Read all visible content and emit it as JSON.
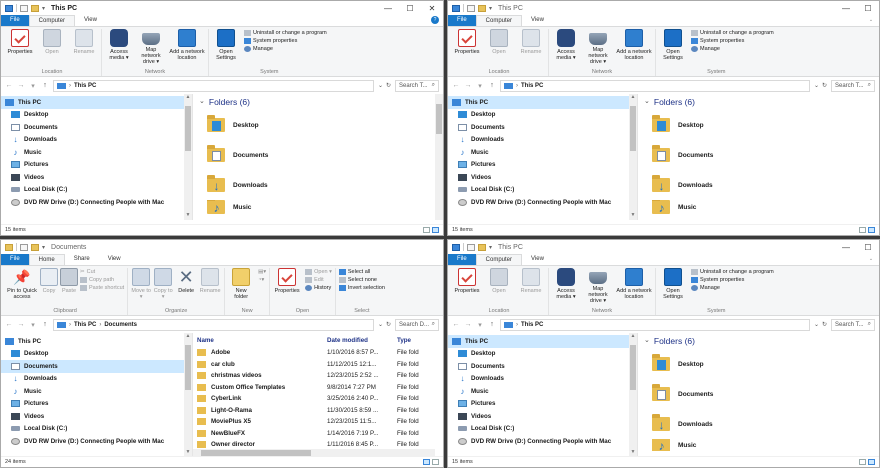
{
  "top_left": {
    "title": "This PC",
    "tabs": [
      "File",
      "Computer",
      "View"
    ],
    "ribbon": {
      "location": {
        "label": "Location",
        "items": [
          "Properties",
          "Open",
          "Rename"
        ]
      },
      "network": {
        "label": "Network",
        "items": [
          "Access media ▾",
          "Map network drive ▾",
          "Add a network location"
        ]
      },
      "system": {
        "label": "System",
        "open_settings": "Open Settings",
        "small": [
          "Uninstall or change a program",
          "System properties",
          "Manage"
        ]
      }
    },
    "address": {
      "crumb": "This PC",
      "search": "Search T..."
    },
    "nav": [
      "This PC",
      "Desktop",
      "Documents",
      "Downloads",
      "Music",
      "Pictures",
      "Videos",
      "Local Disk (C:)",
      "DVD RW Drive (D:) Connecting People with Mac"
    ],
    "section": "Folders (6)",
    "folders": [
      "Desktop",
      "Documents",
      "Downloads",
      "Music"
    ],
    "status": "15 items"
  },
  "top_right": {
    "title": "This PC",
    "tabs": [
      "File",
      "Computer",
      "View"
    ],
    "ribbon": {
      "location": {
        "label": "Location",
        "items": [
          "Properties",
          "Open",
          "Rename"
        ]
      },
      "network": {
        "label": "Network",
        "items": [
          "Access media ▾",
          "Map network drive ▾",
          "Add a network location"
        ]
      },
      "system": {
        "label": "System",
        "open_settings": "Open Settings",
        "small": [
          "Uninstall or change a program",
          "System properties",
          "Manage"
        ]
      }
    },
    "address": {
      "crumb": "This PC",
      "search": "Search T..."
    },
    "nav": [
      "This PC",
      "Desktop",
      "Documents",
      "Downloads",
      "Music",
      "Pictures",
      "Videos",
      "Local Disk (C:)",
      "DVD RW Drive (D:) Connecting People with Mac"
    ],
    "section": "Folders (6)",
    "folders": [
      "Desktop",
      "Documents",
      "Downloads",
      "Music"
    ],
    "status": "15 items"
  },
  "bottom_left": {
    "title": "Documents",
    "tabs": [
      "File",
      "Home",
      "Share",
      "View"
    ],
    "ribbon": {
      "clipboard": {
        "label": "Clipboard",
        "items": [
          "Pin to Quick access",
          "Copy",
          "Paste"
        ],
        "small": [
          "Cut",
          "Copy path",
          "Paste shortcut"
        ]
      },
      "organize": {
        "label": "Organize",
        "items": [
          "Move to ▾",
          "Copy to ▾",
          "Delete",
          "Rename"
        ]
      },
      "new": {
        "label": "New",
        "items": [
          "New folder"
        ]
      },
      "open": {
        "label": "Open",
        "items": [
          "Properties"
        ],
        "small": [
          "Open ▾",
          "Edit",
          "History"
        ]
      },
      "select": {
        "label": "Select",
        "small": [
          "Select all",
          "Select none",
          "Invert selection"
        ]
      }
    },
    "address": {
      "crumb1": "This PC",
      "crumb2": "Documents",
      "search": "Search D..."
    },
    "nav": [
      "This PC",
      "Desktop",
      "Documents",
      "Downloads",
      "Music",
      "Pictures",
      "Videos",
      "Local Disk (C:)",
      "DVD RW Drive (D:) Connecting People with Mac"
    ],
    "columns": [
      "Name",
      "Date modified",
      "Type"
    ],
    "files": [
      {
        "name": "Adobe",
        "date": "1/10/2016 8:57 P...",
        "type": "File fold"
      },
      {
        "name": "car club",
        "date": "11/12/2015 12:1...",
        "type": "File fold"
      },
      {
        "name": "christmas videos",
        "date": "12/23/2015 2:52 ...",
        "type": "File fold"
      },
      {
        "name": "Custom Office Templates",
        "date": "9/8/2014 7:27 PM",
        "type": "File fold"
      },
      {
        "name": "CyberLink",
        "date": "3/25/2016 2:40 P...",
        "type": "File fold"
      },
      {
        "name": "Light-O-Rama",
        "date": "11/30/2015 8:59 ...",
        "type": "File fold"
      },
      {
        "name": "MoviePlus X5",
        "date": "12/23/2015 11:5...",
        "type": "File fold"
      },
      {
        "name": "NewBlueFX",
        "date": "1/14/2016 7:19 P...",
        "type": "File fold"
      },
      {
        "name": "Owner director",
        "date": "1/11/2016 8:45 P...",
        "type": "File fold"
      }
    ],
    "status": "24 items"
  },
  "bottom_right": {
    "title": "This PC",
    "tabs": [
      "File",
      "Computer",
      "View"
    ],
    "ribbon": {
      "location": {
        "label": "Location",
        "items": [
          "Properties",
          "Open",
          "Rename"
        ]
      },
      "network": {
        "label": "Network",
        "items": [
          "Access media ▾",
          "Map network drive ▾",
          "Add a network location"
        ]
      },
      "system": {
        "label": "System",
        "open_settings": "Open Settings",
        "small": [
          "Uninstall or change a program",
          "System properties",
          "Manage"
        ]
      }
    },
    "address": {
      "crumb": "This PC",
      "search": "Search T..."
    },
    "nav": [
      "This PC",
      "Desktop",
      "Documents",
      "Downloads",
      "Music",
      "Pictures",
      "Videos",
      "Local Disk (C:)",
      "DVD RW Drive (D:) Connecting People with Mac"
    ],
    "section": "Folders (6)",
    "folders": [
      "Desktop",
      "Documents",
      "Downloads",
      "Music"
    ],
    "status": "15 items"
  }
}
